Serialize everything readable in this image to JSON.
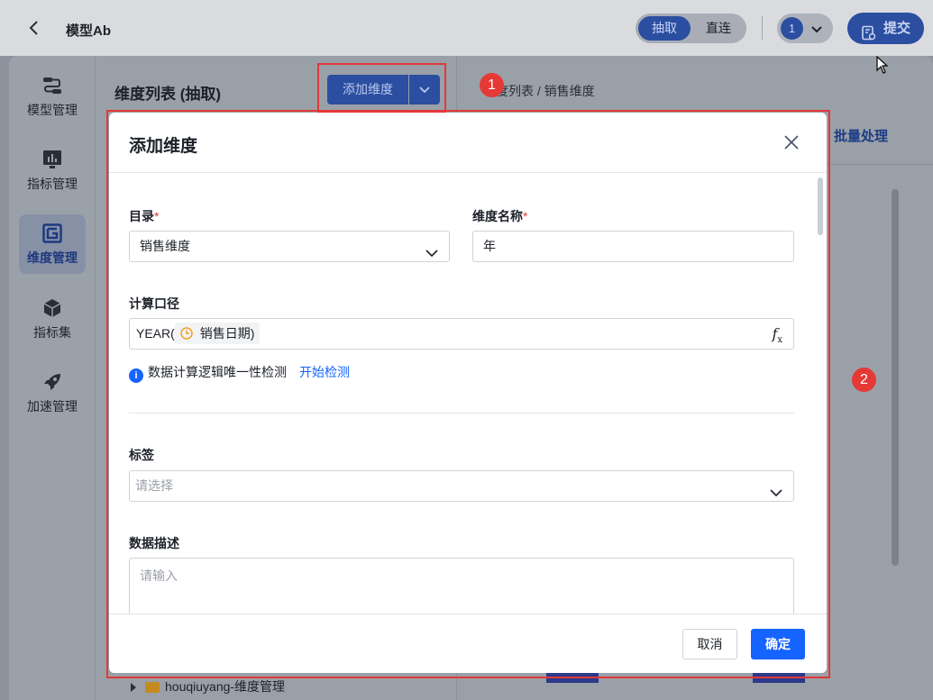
{
  "app": {
    "title": "模型Ab"
  },
  "mode": {
    "active": "抽取",
    "other": "直连"
  },
  "version": {
    "number": "1"
  },
  "toolbar": {
    "submit_label": "提交"
  },
  "sidebar": {
    "items": [
      {
        "label": "模型管理",
        "icon": "model-icon"
      },
      {
        "label": "指标管理",
        "icon": "metric-icon"
      },
      {
        "label": "维度管理",
        "icon": "dimension-icon",
        "active": true
      },
      {
        "label": "指标集",
        "icon": "cube-icon"
      },
      {
        "label": "加速管理",
        "icon": "rocket-icon"
      }
    ]
  },
  "list_pane": {
    "title": "维度列表 (抽取)",
    "add_button": "添加维度",
    "tree_item": "houqiuyang-维度管理"
  },
  "detail_pane": {
    "breadcrumb": "度列表 / 销售维度",
    "bulk_label": "批量处理"
  },
  "badges": {
    "one": "1",
    "two": "2"
  },
  "modal": {
    "title": "添加维度",
    "catalog": {
      "label": "目录",
      "required": "*",
      "value": "销售维度"
    },
    "name": {
      "label": "维度名称",
      "required": "*",
      "value": "年"
    },
    "formula": {
      "label": "计算口径",
      "prefix": "YEAR(",
      "field": "销售日期",
      "suffix": ")",
      "fx": "f"
    },
    "hint": {
      "icon": "i",
      "text": "数据计算逻辑唯一性检测",
      "link": "开始检测"
    },
    "tags": {
      "label": "标签",
      "placeholder": "请选择"
    },
    "description": {
      "label": "数据描述",
      "placeholder": "请输入"
    },
    "cancel": "取消",
    "confirm": "确定"
  },
  "colors": {
    "accent": "#1664ff",
    "annotation": "#e33838",
    "dim_primary": "#2b4ea1"
  }
}
